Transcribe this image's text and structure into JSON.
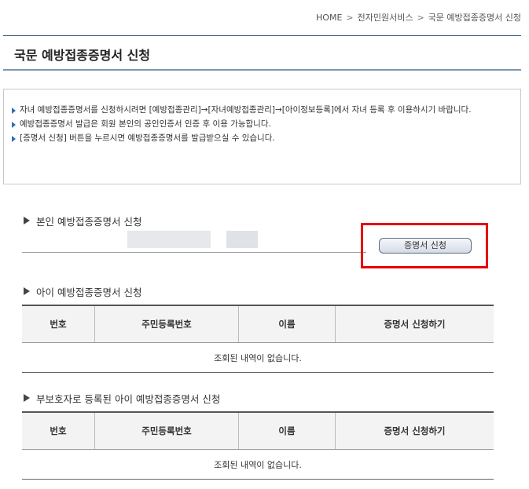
{
  "breadcrumb": {
    "home": "HOME",
    "sep": ">",
    "level1": "전자민원서비스",
    "level2": "국문 예방접종증명서 신청"
  },
  "page_title": "국문 예방접종증명서 신청",
  "notice": [
    "자녀 예방접종증명서를 신청하시려면 [예방접종관리]→[자녀예방접종관리]→[아이정보등록]에서 자녀 등록 후 이용하시기 바랍니다.",
    "예방접종증명서 발급은 회원 본인의 공인인증서 인증 후 이용 가능합니다.",
    "[증명서 신청] 버튼을 누르시면 예방접종증명서를 발급받으실 수 있습니다."
  ],
  "self_section": {
    "title": "본인 예방접종증명서 신청",
    "button": "증명서 신청"
  },
  "child_section": {
    "title": "아이 예방접종증명서 신청",
    "columns": [
      "번호",
      "주민등록번호",
      "이름",
      "증명서 신청하기"
    ],
    "empty": "조회된 내역이 없습니다."
  },
  "guardian_section": {
    "title": "부보호자로 등록된 아이 예방접종증명서 신청",
    "columns": [
      "번호",
      "주민등록번호",
      "이름",
      "증명서 신청하기"
    ],
    "empty": "조회된 내역이 없습니다."
  },
  "colors": {
    "accent": "#2e6db4",
    "highlight": "#e80000",
    "title_line": "#2b4f7a"
  }
}
